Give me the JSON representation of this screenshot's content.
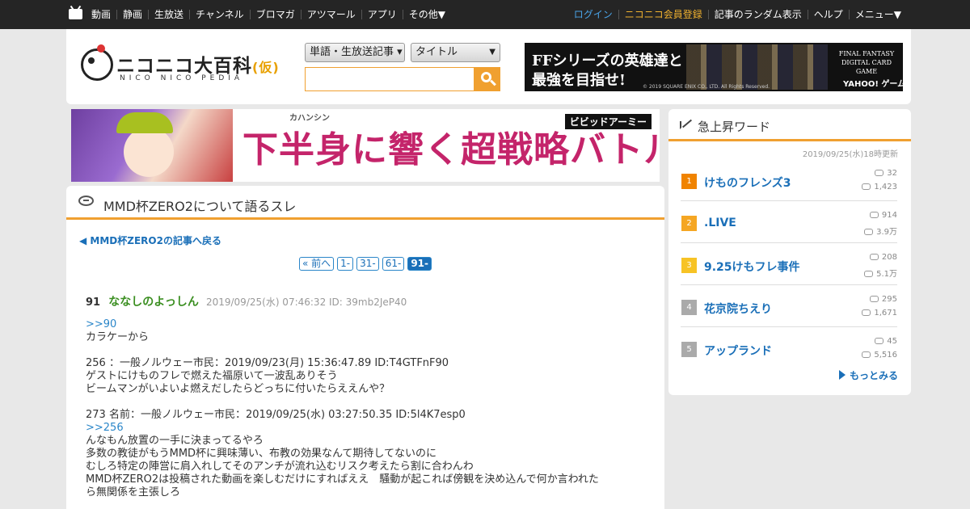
{
  "topnav": {
    "left": [
      "動画",
      "静画",
      "生放送",
      "チャンネル",
      "ブロマガ",
      "アツマール",
      "アプリ",
      "その他▼"
    ],
    "right": {
      "login": "ログイン",
      "register": "ニコニコ会員登録",
      "random": "記事のランダム表示",
      "help": "ヘルプ",
      "menu": "メニュー▼"
    }
  },
  "logo": {
    "main": "ニコニコ大百科",
    "saku": "(仮)",
    "sub": "NICO NICO PEDIA"
  },
  "search": {
    "type_select": "単語・生放送記事 ▾",
    "field_select": "タイトル",
    "field_arrow": "▼",
    "query": ""
  },
  "ad_ff": {
    "line1": "FFシリーズの英雄達と",
    "line2": "最強を目指せ!",
    "logo": "FINAL FANTASY DIGITAL CARD GAME",
    "copyright": "© 2019 SQUARE ENIX CO., LTD. All Rights Reserved.",
    "partner": "YAHOO! ゲーム"
  },
  "banner": {
    "text": "下半身に響く超戦略バトル",
    "ruby": "カハンシン",
    "brand": "ビビッドアーミー"
  },
  "thread": {
    "title": "MMD杯ZERO2について語るスレ",
    "back": "MMD杯ZERO2の記事へ戻る",
    "pager": [
      "« 前へ",
      "1-",
      "31-",
      "61-",
      "91-"
    ],
    "post": {
      "number": "91",
      "name": "ななしのよっしん",
      "meta": "2019/09/25(水) 07:46:32 ID: 39mb2JeP40",
      "lines": [
        ">>90",
        "カラケーから",
        "",
        "256 ：一般ノルウェー市民：2019/09/23(月) 15:36:47.89 ID:T4GTFnF90",
        "ゲストにけものフレで燃えた福原いて一波乱ありそう",
        "ビームマンがいよいよ燃えだしたらどっちに付いたらええんや？",
        "",
        "273 名前：一般ノルウェー市民：2019/09/25(水) 03:27:50.35 ID:5l4K7esp0",
        ">>256",
        "んなもん放置の一手に決まってるやろ",
        "多数の教徒がもうMMD杯に興味薄い、布教の効果なんて期待してないのに",
        "むしろ特定の陣営に肩入れしてそのアンチが流れ込むリスク考えたら割に合わんわ",
        "MMD杯ZERO2は投稿された動画を楽しむだけにすればええ　騒動が起これば傍観を決め込んで何か言われた",
        "ら無関係を主張しろ"
      ]
    }
  },
  "sidebar": {
    "title": "急上昇ワード",
    "updated": "2019/09/25(水)18時更新",
    "more": "もっとみる",
    "ranks": [
      {
        "rank": "1",
        "word": "けものフレンズ3",
        "views": "32",
        "comments": "1,423",
        "color": "#f08300"
      },
      {
        "rank": "2",
        "word": ".LIVE",
        "views": "914",
        "comments": "3.9万",
        "color": "#f5a623"
      },
      {
        "rank": "3",
        "word": "9.25けもフレ事件",
        "views": "208",
        "comments": "5.1万",
        "color": "#f7c325"
      },
      {
        "rank": "4",
        "word": "花京院ちえり",
        "views": "295",
        "comments": "1,671",
        "color": "#aaaaaa"
      },
      {
        "rank": "5",
        "word": "アップランド",
        "views": "45",
        "comments": "5,516",
        "color": "#aaaaaa"
      }
    ]
  }
}
